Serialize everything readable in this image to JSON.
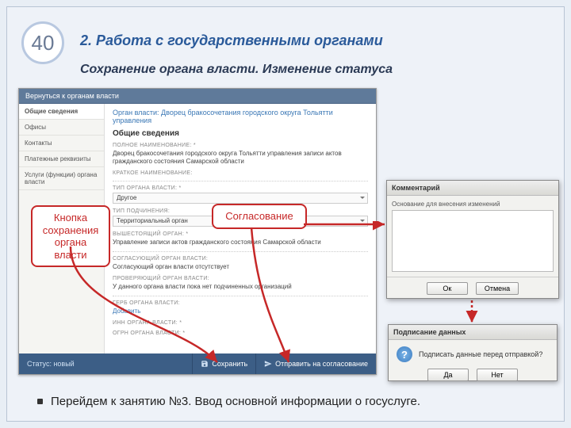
{
  "slide": {
    "number": "40",
    "title": "2. Работа с государственными органами",
    "subtitle": "Сохранение органа власти. Изменение статуса",
    "footer_note": "Перейдем к занятию №3. Ввод основной информации о госуслуге."
  },
  "screenshot": {
    "back_link": "Вернуться к органам власти",
    "breadcrumb": "Орган власти: Дворец бракосочетания городского округа Тольятти управления",
    "section_heading": "Общие сведения",
    "sidebar": [
      {
        "label": "Общие сведения",
        "active": true
      },
      {
        "label": "Офисы",
        "active": false
      },
      {
        "label": "Контакты",
        "active": false
      },
      {
        "label": "Платежные реквизиты",
        "active": false
      },
      {
        "label": "Услуги (функции) органа власти",
        "active": false
      }
    ],
    "fields": {
      "full_name_label": "ПОЛНОЕ НАИМЕНОВАНИЕ: *",
      "full_name_value": "Дворец бракосочетания городского округа Тольятти управления записи актов гражданского состояния Самарской области",
      "short_name_label": "КРАТКОЕ НАИМЕНОВАНИЕ:",
      "type_label": "ТИП ОРГАНА ВЛАСТИ: *",
      "type_value": "Другое",
      "subord_label": "ТИП ПОДЧИНЕНИЯ:",
      "subord_value": "Территориальный орган",
      "parent_label": "ВЫШЕСТОЯЩИЙ ОРГАН: *",
      "parent_value": "Управление записи актов гражданского состояния Самарской области",
      "approve_label": "СОГЛАСУЮЩИЙ ОРГАН ВЛАСТИ:",
      "approve_value": "Согласующий орган власти отсутствует",
      "review_label": "ПРОВЕРЯЮЩИЙ ОРГАН ВЛАСТИ:",
      "review_value": "У данного органа власти пока нет подчиненных организаций",
      "gerb_label": "ГЕРБ ОРГАНА ВЛАСТИ:",
      "gerb_value": "Добавить",
      "inn_label": "ИНН ОРГАНА ВЛАСТИ: *",
      "ogrn_label": "ОГРН ОРГАНА ВЛАСТИ: *"
    },
    "footer": {
      "status": "Статус: новый",
      "save": "Сохранить",
      "send": "Отправить на согласование"
    }
  },
  "callout_save": "Кнопка сохранения органа власти",
  "callout_approve": "Согласование",
  "dialog_comment": {
    "title": "Комментарий",
    "label": "Основание для внесения изменений",
    "ok": "Ок",
    "cancel": "Отмена"
  },
  "dialog_sign": {
    "title": "Подписание данных",
    "question": "Подписать данные перед отправкой?",
    "yes": "Да",
    "no": "Нет"
  }
}
